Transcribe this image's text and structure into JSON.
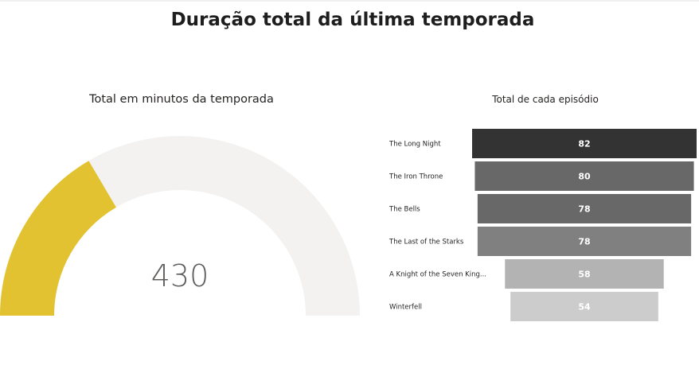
{
  "page": {
    "title": "Duração total da última temporada"
  },
  "chart_data": [
    {
      "type": "gauge",
      "title": "Total em minutos da temporada",
      "value": 430,
      "min": 0,
      "max": 1300,
      "colors": {
        "fill": "#e2c230",
        "track": "#f3f2f1",
        "value_text": "#605e5c"
      }
    },
    {
      "type": "funnel",
      "title": "Total de cada episódio",
      "categories": [
        "The Long Night",
        "The Iron Throne",
        "The Bells",
        "The Last of the Starks",
        "A Knight of the Seven King...",
        "Winterfell"
      ],
      "values": [
        82,
        80,
        78,
        78,
        58,
        54
      ],
      "colors": [
        "#333333",
        "#686868",
        "#686868",
        "#808080",
        "#b3b3b3",
        "#cccccc"
      ]
    }
  ]
}
